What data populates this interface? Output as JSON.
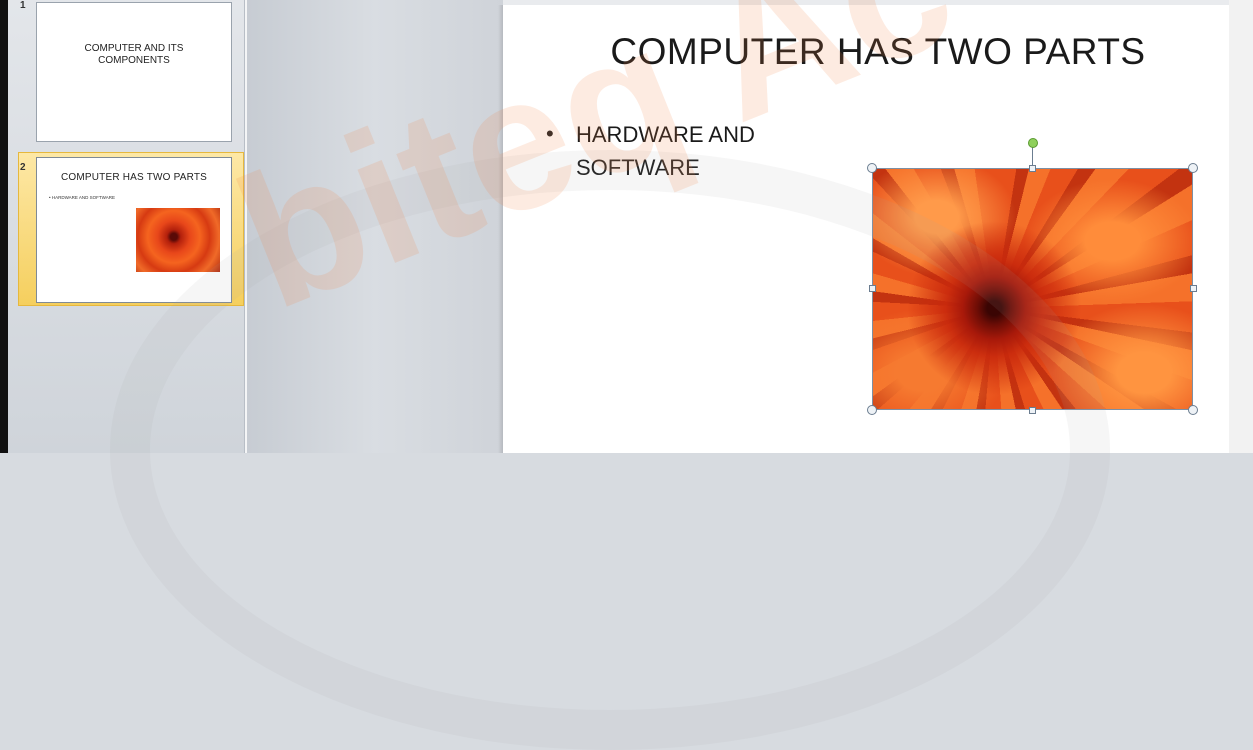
{
  "thumbnails": [
    {
      "number": "1",
      "title": "COMPUTER AND ITS COMPONENTS"
    },
    {
      "number": "2",
      "title": "COMPUTER HAS TWO PARTS",
      "bullet": "• HARDWARE AND SOFTWARE",
      "image": "flower-image"
    }
  ],
  "slide": {
    "title": "COMPUTER HAS TWO PARTS",
    "bullet_marker": "•",
    "bullet_text": "HARDWARE AND SOFTWARE",
    "picture": "orange-chrysanthemum-photo"
  },
  "watermark": {
    "text": "biteq Ac"
  },
  "colors": {
    "selected_thumb": "#f5cf5e",
    "rotate_handle": "#8fd05c"
  }
}
